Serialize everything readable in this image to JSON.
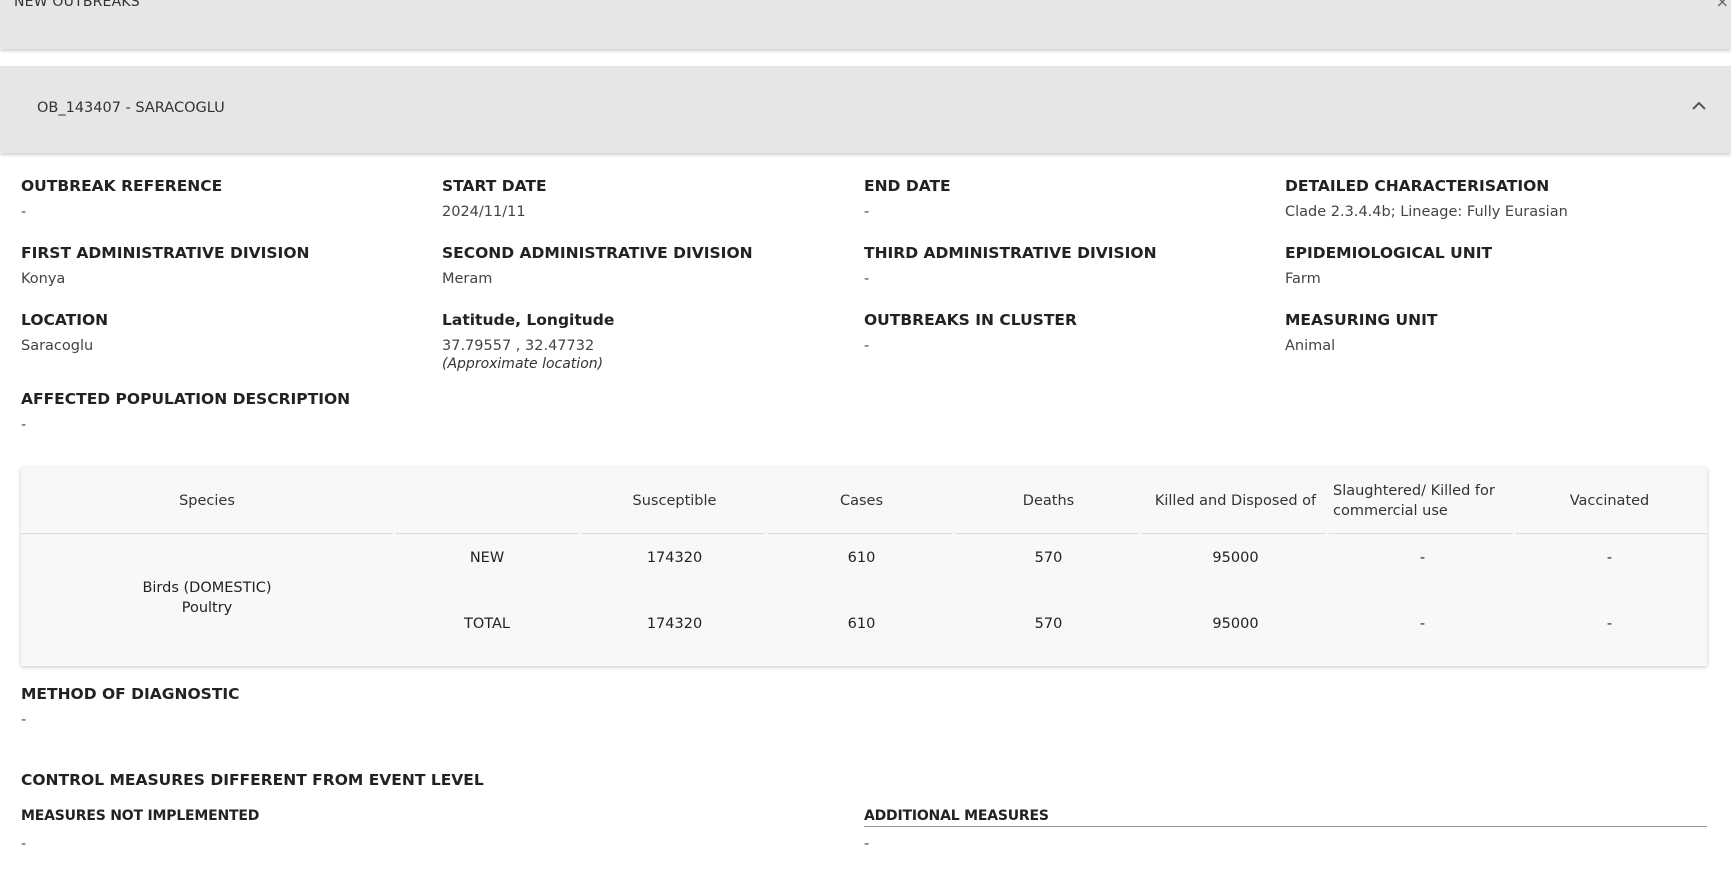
{
  "top_panel": {
    "title": "NEW OUTBREAKS",
    "close_glyph": "×"
  },
  "outbreak": {
    "title": "OB_143407 - SARACOGLU"
  },
  "fields": {
    "outbreak_reference": {
      "label": "OUTBREAK REFERENCE",
      "value": "-"
    },
    "start_date": {
      "label": "START DATE",
      "value": "2024/11/11"
    },
    "end_date": {
      "label": "END DATE",
      "value": "-"
    },
    "detailed_characterisation": {
      "label": "DETAILED CHARACTERISATION",
      "value": "Clade 2.3.4.4b; Lineage: Fully Eurasian"
    },
    "first_admin": {
      "label": "FIRST ADMINISTRATIVE DIVISION",
      "value": "Konya"
    },
    "second_admin": {
      "label": "SECOND ADMINISTRATIVE DIVISION",
      "value": "Meram"
    },
    "third_admin": {
      "label": "THIRD ADMINISTRATIVE DIVISION",
      "value": "-"
    },
    "epi_unit": {
      "label": "EPIDEMIOLOGICAL UNIT",
      "value": "Farm"
    },
    "location": {
      "label": "LOCATION",
      "value": "Saracoglu"
    },
    "lat_long": {
      "label": "Latitude, Longitude",
      "value": "37.79557 , 32.47732",
      "note": "(Approximate location)"
    },
    "outbreaks_in_cluster": {
      "label": "OUTBREAKS IN CLUSTER",
      "value": "-"
    },
    "measuring_unit": {
      "label": "MEASURING UNIT",
      "value": "Animal"
    },
    "affected_population": {
      "label": "AFFECTED POPULATION DESCRIPTION",
      "value": "-"
    }
  },
  "table": {
    "headers": {
      "species": "Species",
      "susceptible": "Susceptible",
      "cases": "Cases",
      "deaths": "Deaths",
      "killed": "Killed and Disposed of",
      "slaughtered_1": "Slaughtered/ Killed for",
      "slaughtered_2": "commercial use",
      "vaccinated": "Vaccinated"
    },
    "species_line1": "Birds (DOMESTIC)",
    "species_line2": "Poultry",
    "rows": [
      {
        "type": "NEW",
        "susceptible": "174320",
        "cases": "610",
        "deaths": "570",
        "killed": "95000",
        "slaughtered": "-",
        "vaccinated": "-"
      },
      {
        "type": "TOTAL",
        "susceptible": "174320",
        "cases": "610",
        "deaths": "570",
        "killed": "95000",
        "slaughtered": "-",
        "vaccinated": "-"
      }
    ]
  },
  "method_of_diagnostic": {
    "label": "METHOD OF DIAGNOSTIC",
    "value": "-"
  },
  "control_measures": {
    "title": "CONTROL MEASURES DIFFERENT FROM EVENT LEVEL",
    "not_implemented_label": "MEASURES NOT IMPLEMENTED",
    "not_implemented_value": "-",
    "additional_label": "ADDITIONAL MEASURES",
    "additional_value": "-"
  }
}
